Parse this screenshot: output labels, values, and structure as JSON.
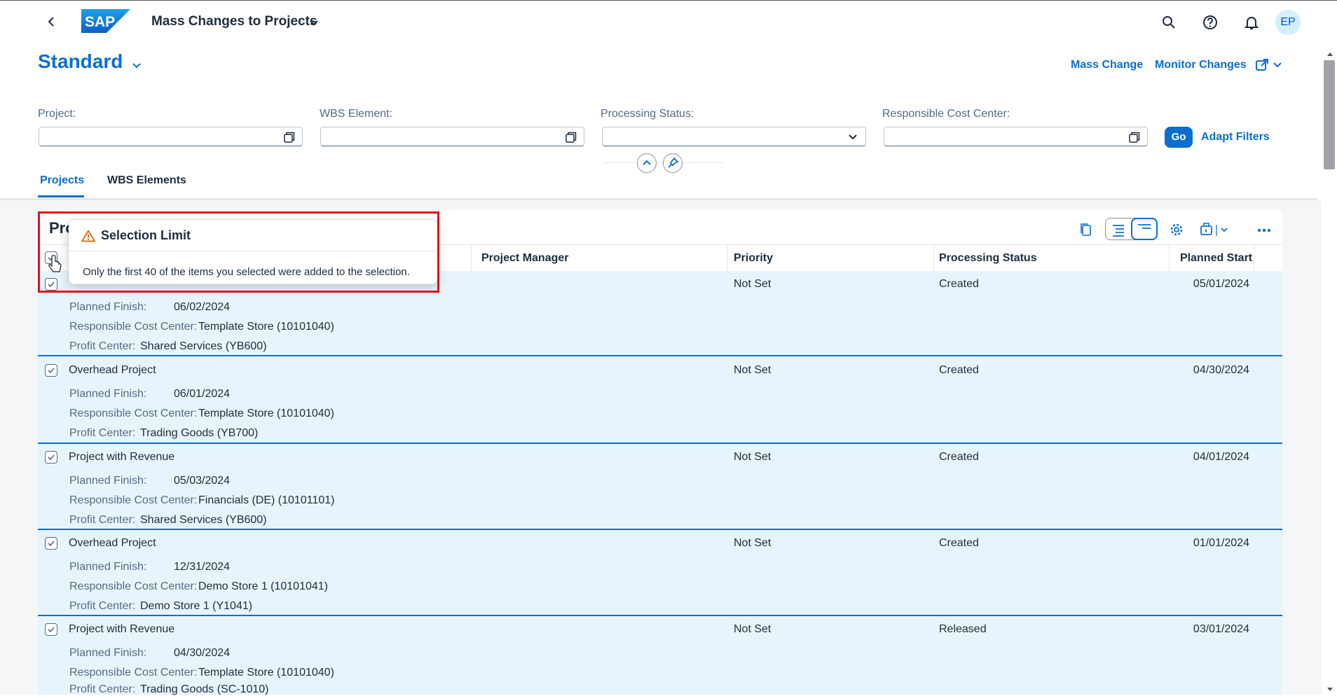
{
  "shell": {
    "app_title": "Mass Changes to Projects",
    "logo_text": "SAP",
    "avatar_initials": "EP",
    "icons": [
      "back-icon",
      "search-icon",
      "help-icon",
      "notification-bell-icon"
    ]
  },
  "header": {
    "variant": "Standard",
    "actions": {
      "mass_change": "Mass Change",
      "monitor_changes": "Monitor Changes"
    }
  },
  "filters": {
    "project_label": "Project:",
    "wbs_label": "WBS Element:",
    "processing_status_label": "Processing Status:",
    "cost_center_label": "Responsible Cost Center:",
    "go": "Go",
    "adapt_filters": "Adapt Filters"
  },
  "tabs": [
    {
      "label": "Projects",
      "active": true
    },
    {
      "label": "WBS Elements",
      "active": false
    }
  ],
  "table": {
    "title_visible": "Pro",
    "columns": [
      "Project Manager",
      "Priority",
      "Processing Status",
      "Planned Start"
    ],
    "labels": {
      "planned_finish": "Planned Finish:",
      "cost_center": "Responsible Cost Center:",
      "profit_center": "Profit Center:"
    },
    "rows": [
      {
        "name": "",
        "priority": "Not Set",
        "status": "Created",
        "planned_start": "05/01/2024",
        "planned_finish": "06/02/2024",
        "cost_center": "Template Store (10101040)",
        "profit_center": "Shared Services (YB600)"
      },
      {
        "name": "Overhead Project",
        "priority": "Not Set",
        "status": "Created",
        "planned_start": "04/30/2024",
        "planned_finish": "06/01/2024",
        "cost_center": "Template Store (10101040)",
        "profit_center": "Trading Goods (YB700)"
      },
      {
        "name": "Project with Revenue",
        "priority": "Not Set",
        "status": "Created",
        "planned_start": "04/01/2024",
        "planned_finish": "05/03/2024",
        "cost_center": "Financials (DE) (10101101)",
        "profit_center": "Shared Services (YB600)"
      },
      {
        "name": "Overhead Project",
        "priority": "Not Set",
        "status": "Created",
        "planned_start": "01/01/2024",
        "planned_finish": "12/31/2024",
        "cost_center": "Demo Store 1 (10101041)",
        "profit_center": "Demo Store 1 (Y1041)"
      },
      {
        "name": "Project with Revenue",
        "priority": "Not Set",
        "status": "Released",
        "planned_start": "03/01/2024",
        "planned_finish": "04/30/2024",
        "cost_center": "Template Store (10101040)",
        "profit_center": "Trading Goods (SC-1010)"
      }
    ]
  },
  "popover": {
    "title": "Selection Limit",
    "message": "Only the first 40 of the items you selected were added to the selection."
  },
  "colors": {
    "brand": "#0a6ed1",
    "row_selected": "#e8f4fc",
    "highlight": "#e0101c",
    "warning": "#e76500"
  }
}
